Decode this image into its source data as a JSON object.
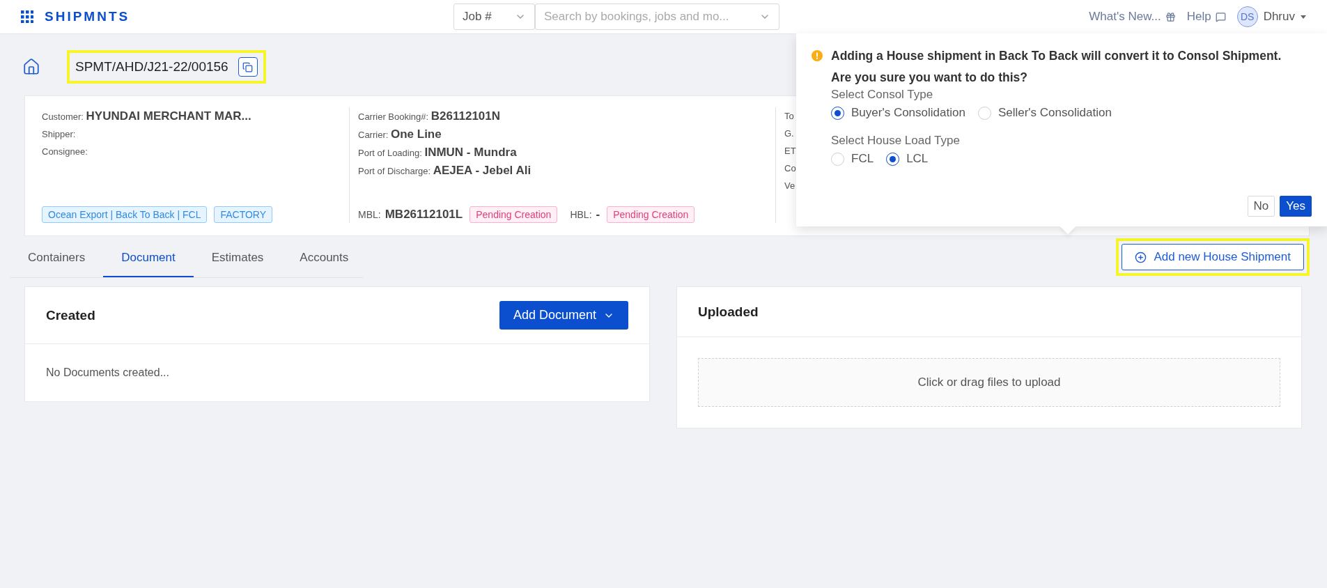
{
  "topbar": {
    "logo": "SHIPMNTS",
    "search_type": "Job #",
    "search_placeholder": "Search by bookings, jobs and mo...",
    "links": [
      {
        "label": "What's New...",
        "kind": "gift"
      },
      {
        "label": "Help",
        "kind": "chat"
      }
    ],
    "user": {
      "initials": "DS",
      "name": "Dhruv"
    }
  },
  "job": {
    "number": "SPMT/AHD/J21-22/00156",
    "highlighted": true
  },
  "summary": {
    "columns": [
      {
        "fields": [
          {
            "label": "Customer:",
            "value": "HYUNDAI MERCHANT MAR..."
          },
          {
            "label": "Shipper:"
          },
          {
            "label": "Consignee:"
          }
        ],
        "tags": [
          "Ocean Export | Back To Back | FCL",
          "FACTORY"
        ]
      },
      {
        "fields": [
          {
            "label": "Carrier Booking#:",
            "value": "B26112101N"
          },
          {
            "label": "Carrier:",
            "value": "One Line"
          },
          {
            "label": "Port of Loading:",
            "value": "INMUN - Mundra"
          },
          {
            "label": "Port of Discharge:",
            "value": "AEJEA - Jebel Ali"
          }
        ],
        "bills": [
          {
            "label": "MBL:",
            "value": "MB26112101L",
            "status": "Pending Creation"
          },
          {
            "label": "HBL:",
            "value": "-",
            "status": "Pending Creation"
          }
        ]
      },
      {
        "fields": [
          {
            "label": "To"
          },
          {
            "label": "G."
          },
          {
            "label": "ET"
          },
          {
            "label": "Co"
          },
          {
            "label": "Ve"
          }
        ]
      }
    ]
  },
  "tabs": [
    {
      "label": "Containers",
      "selected": false
    },
    {
      "label": "Document",
      "selected": true
    },
    {
      "label": "Estimates",
      "selected": false
    },
    {
      "label": "Accounts",
      "selected": false
    }
  ],
  "add_house_button": {
    "label": "Add new House Shipment",
    "highlighted": true
  },
  "created_panel": {
    "title": "Created",
    "button": "Add Document",
    "empty": "No Documents created..."
  },
  "uploaded_panel": {
    "title": "Uploaded",
    "dropzone": "Click or drag files to upload"
  },
  "popup": {
    "message": "Adding a House shipment in Back To Back will convert it to Consol Shipment.",
    "question": "Are you sure you want to do this?",
    "groups": [
      {
        "label": "Select Consol Type",
        "options": [
          {
            "label": "Buyer's Consolidation",
            "selected": true
          },
          {
            "label": "Seller's Consolidation",
            "selected": false
          }
        ]
      },
      {
        "label": "Select House Load Type",
        "options": [
          {
            "label": "FCL",
            "selected": false
          },
          {
            "label": "LCL",
            "selected": true
          }
        ]
      }
    ],
    "buttons": [
      {
        "label": "No",
        "kind": "default"
      },
      {
        "label": "Yes",
        "kind": "primary"
      }
    ]
  }
}
